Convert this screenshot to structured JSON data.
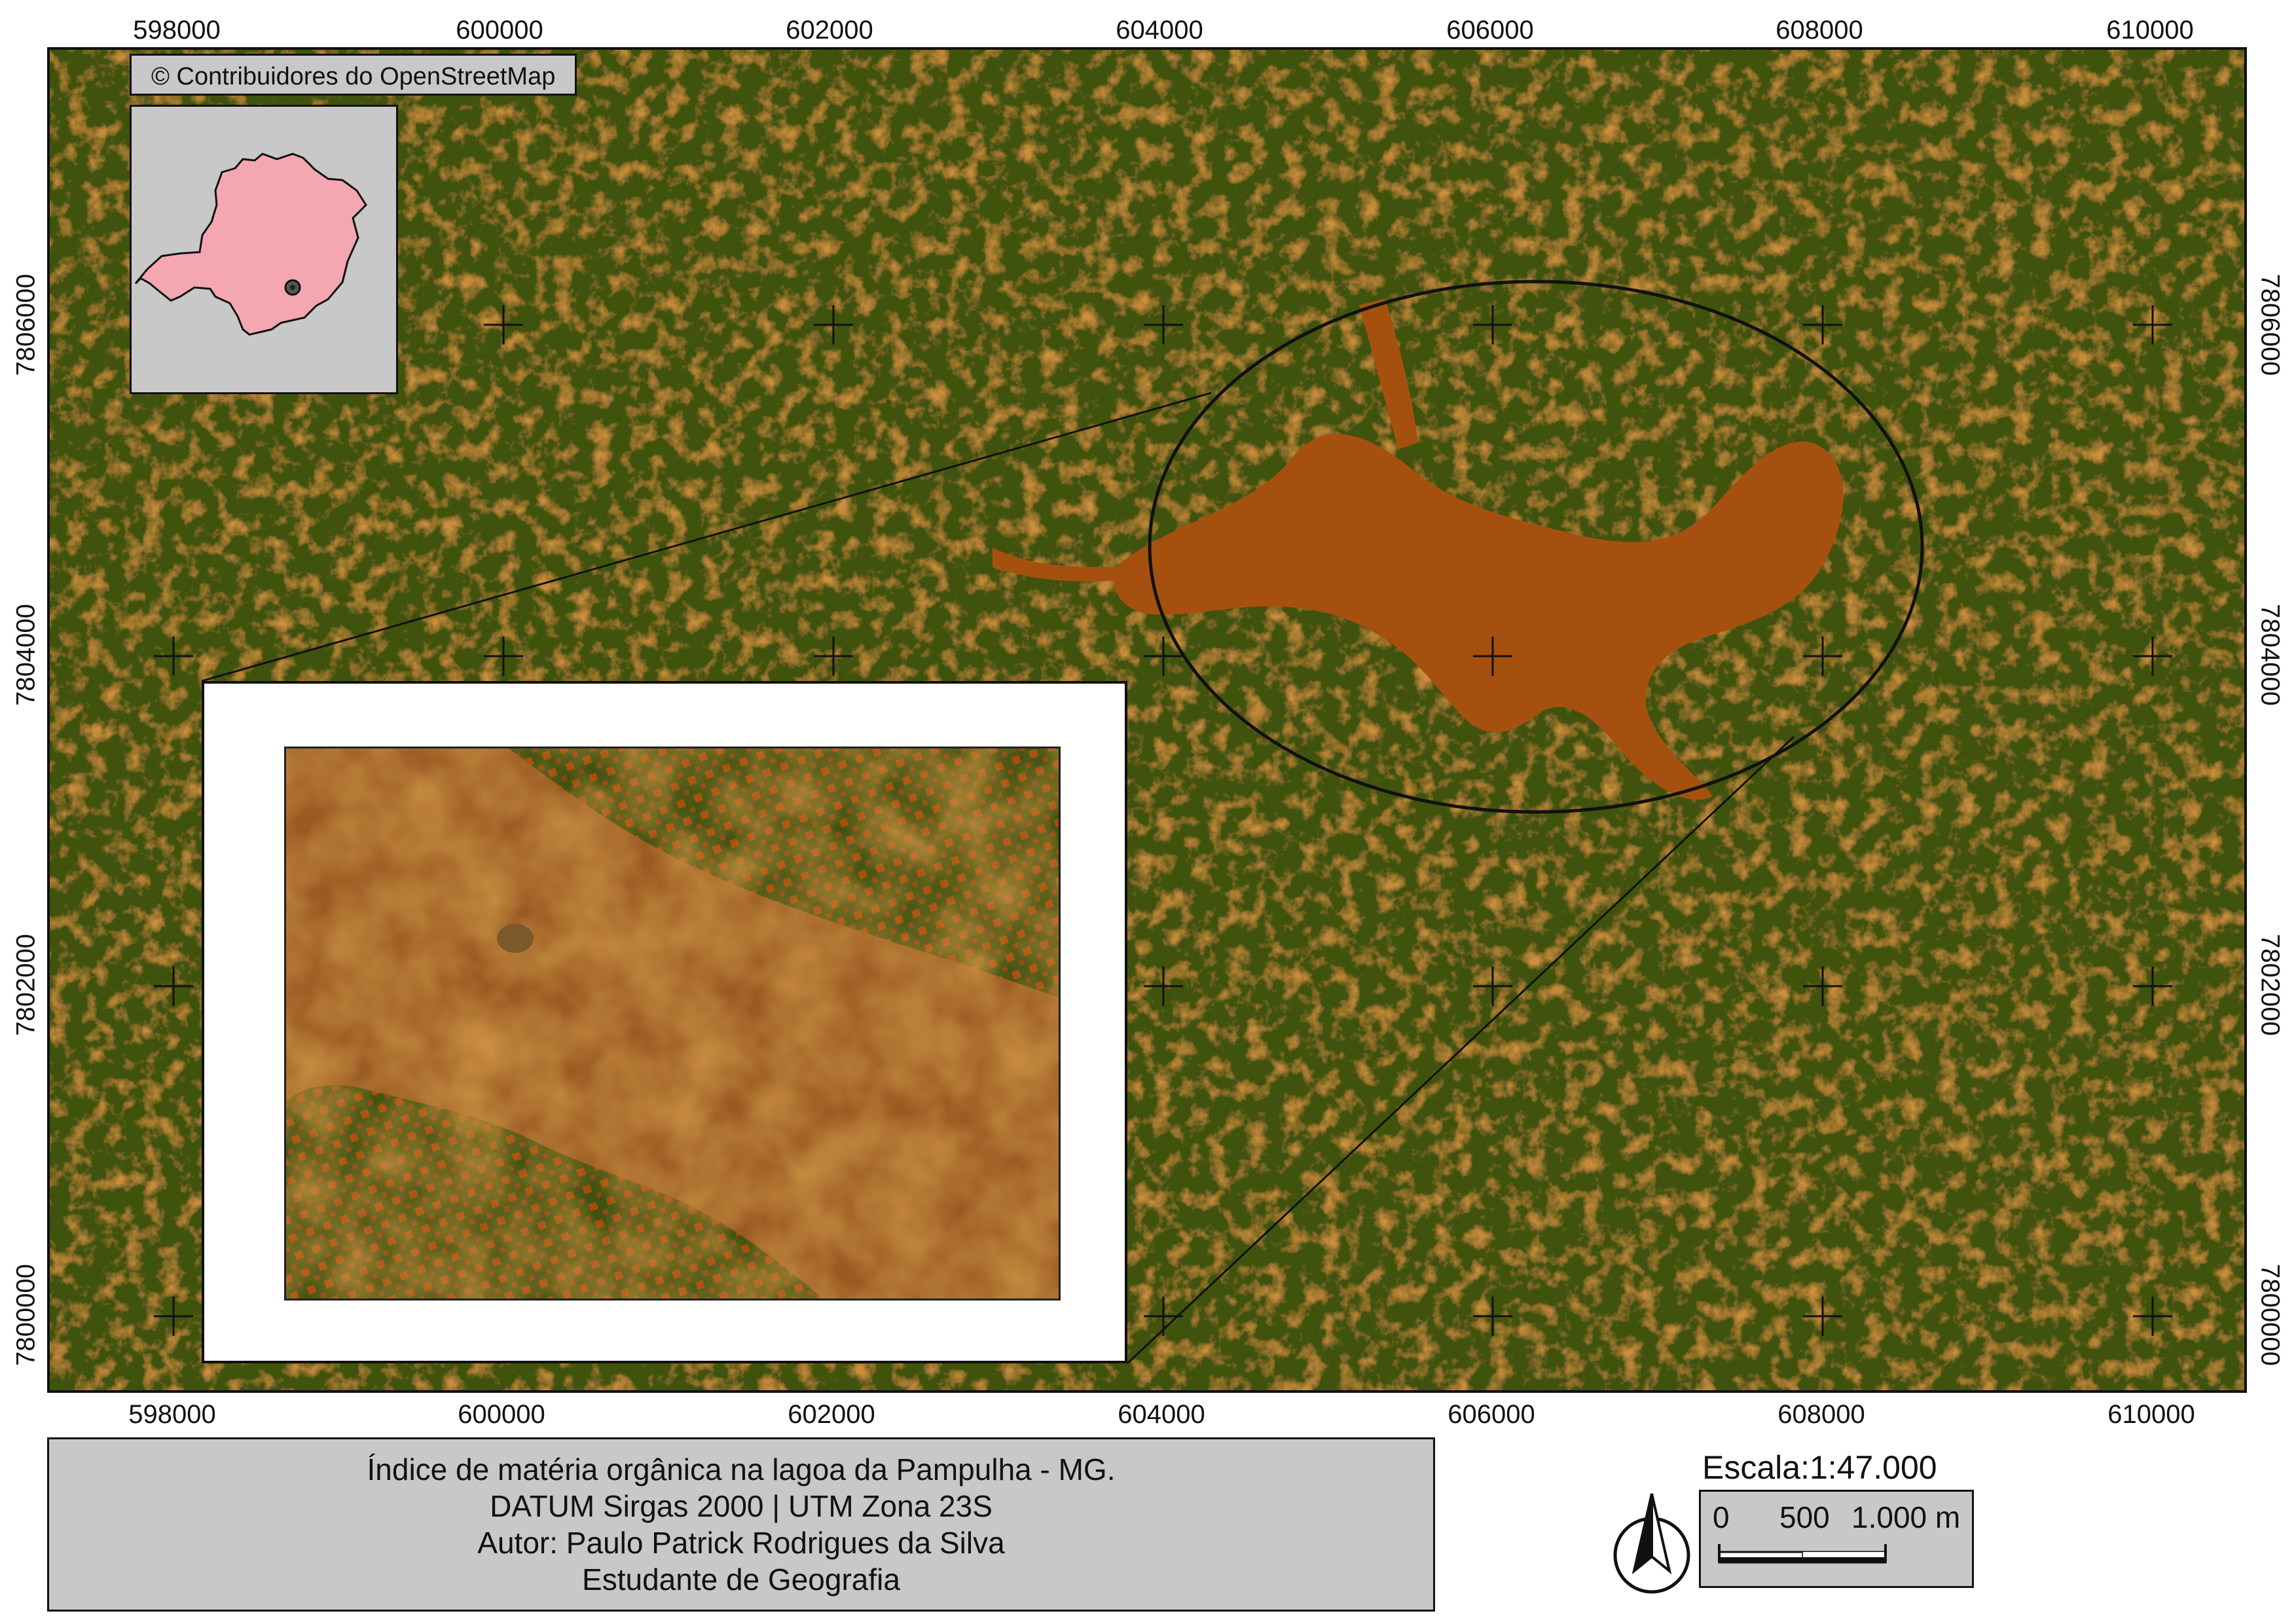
{
  "map": {
    "attribution": "© Contribuidores do OpenStreetMap",
    "colors": {
      "vegetation": "#3f5210",
      "bare_soil_water": "#a64a0c",
      "lagoon": "#a6500f",
      "locator_state": "#f4a7b1",
      "frame": "#111111"
    },
    "grid": {
      "x_labels": [
        "598000",
        "600000",
        "602000",
        "604000",
        "606000",
        "608000",
        "610000"
      ],
      "y_labels": [
        "7806000",
        "7804000",
        "7802000",
        "7800000"
      ]
    },
    "locator": {
      "region": "Minas Gerais",
      "marker": "study-area-marker"
    },
    "title": {
      "line1": "Índice de matéria orgânica na lagoa da Pampulha - MG.",
      "line2": "DATUM Sirgas 2000 | UTM Zona 23S",
      "line3": "Autor: Paulo Patrick Rodrigues da Silva",
      "line4": "Estudante de Geografia"
    },
    "scale": {
      "title": "Escala:1:47.000",
      "tick0": "0",
      "tick1": "500",
      "tick2": "1.000 m"
    },
    "north_arrow_icon": "north-arrow-icon"
  }
}
